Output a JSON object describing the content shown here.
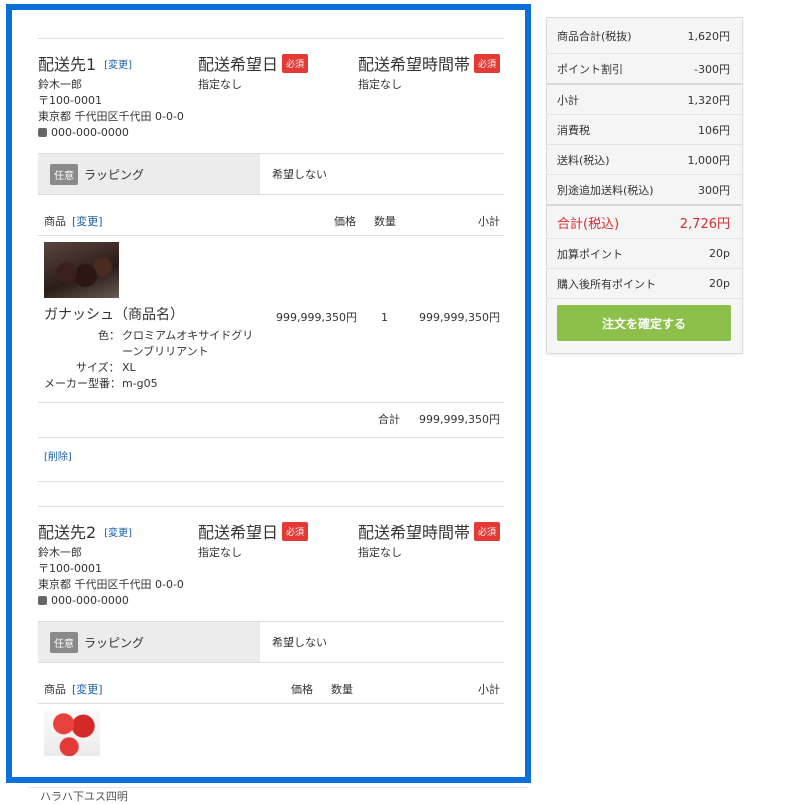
{
  "destinations": [
    {
      "label": "配送先1",
      "change": "[変更]",
      "name": "鈴木一郎",
      "zip": "〒100-0001",
      "address": "東京都 千代田区千代田 0-0-0",
      "phone": "000-000-0000",
      "date_label": "配送希望日",
      "date_value": "指定なし",
      "time_label": "配送希望時間帯",
      "time_value": "指定なし",
      "required": "必須",
      "wrap_badge": "任意",
      "wrap_label": "ラッピング",
      "wrap_value": "希望しない",
      "headers": {
        "product": "商品",
        "change": "[変更]",
        "price": "価格",
        "qty": "数量",
        "subtotal": "小計"
      },
      "item": {
        "image": "chocolate-photo",
        "name": "ガナッシュ（商品名）",
        "color_label": "色：",
        "color_value_1": "クロミアムオキサイドグリ",
        "color_value_2": "ーンブリリアント",
        "size_label": "サイズ：",
        "size_value": "XL",
        "model_label": "メーカー型番：",
        "model_value": "m-g05",
        "price": "999,999,350円",
        "qty": "1",
        "subtotal": "999,999,350円"
      },
      "total_label": "合計",
      "total_value": "999,999,350円",
      "delete": "[削除]"
    },
    {
      "label": "配送先2",
      "change": "[変更]",
      "name": "鈴木一郎",
      "zip": "〒100-0001",
      "address": "東京都 千代田区千代田 0-0-0",
      "phone": "000-000-0000",
      "date_label": "配送希望日",
      "date_value": "指定なし",
      "time_label": "配送希望時間帯",
      "time_value": "指定なし",
      "required": "必須",
      "wrap_badge": "任意",
      "wrap_label": "ラッピング",
      "wrap_value": "希望しない",
      "headers": {
        "product": "商品",
        "change": "[変更]",
        "price": "価格",
        "qty": "数量",
        "subtotal": "小計"
      },
      "item": {
        "image": "candy-photo"
      }
    }
  ],
  "summary": {
    "rows": [
      {
        "label": "商品合計(税抜)",
        "value": "1,620円"
      },
      {
        "label": "ポイント割引",
        "value": "-300円"
      },
      {
        "label": "小計",
        "value": "1,320円"
      },
      {
        "label": "消費税",
        "value": "106円"
      },
      {
        "label": "送料(税込)",
        "value": "1,000円"
      },
      {
        "label": "別途追加送料(税込)",
        "value": "300円"
      },
      {
        "label": "合計(税込)",
        "value": "2,726円"
      },
      {
        "label": "加算ポイント",
        "value": "20p"
      },
      {
        "label": "購入後所有ポイント",
        "value": "20p"
      }
    ],
    "confirm": "注文を確定する"
  },
  "footer_cut": "ハラハ下ユス四明"
}
